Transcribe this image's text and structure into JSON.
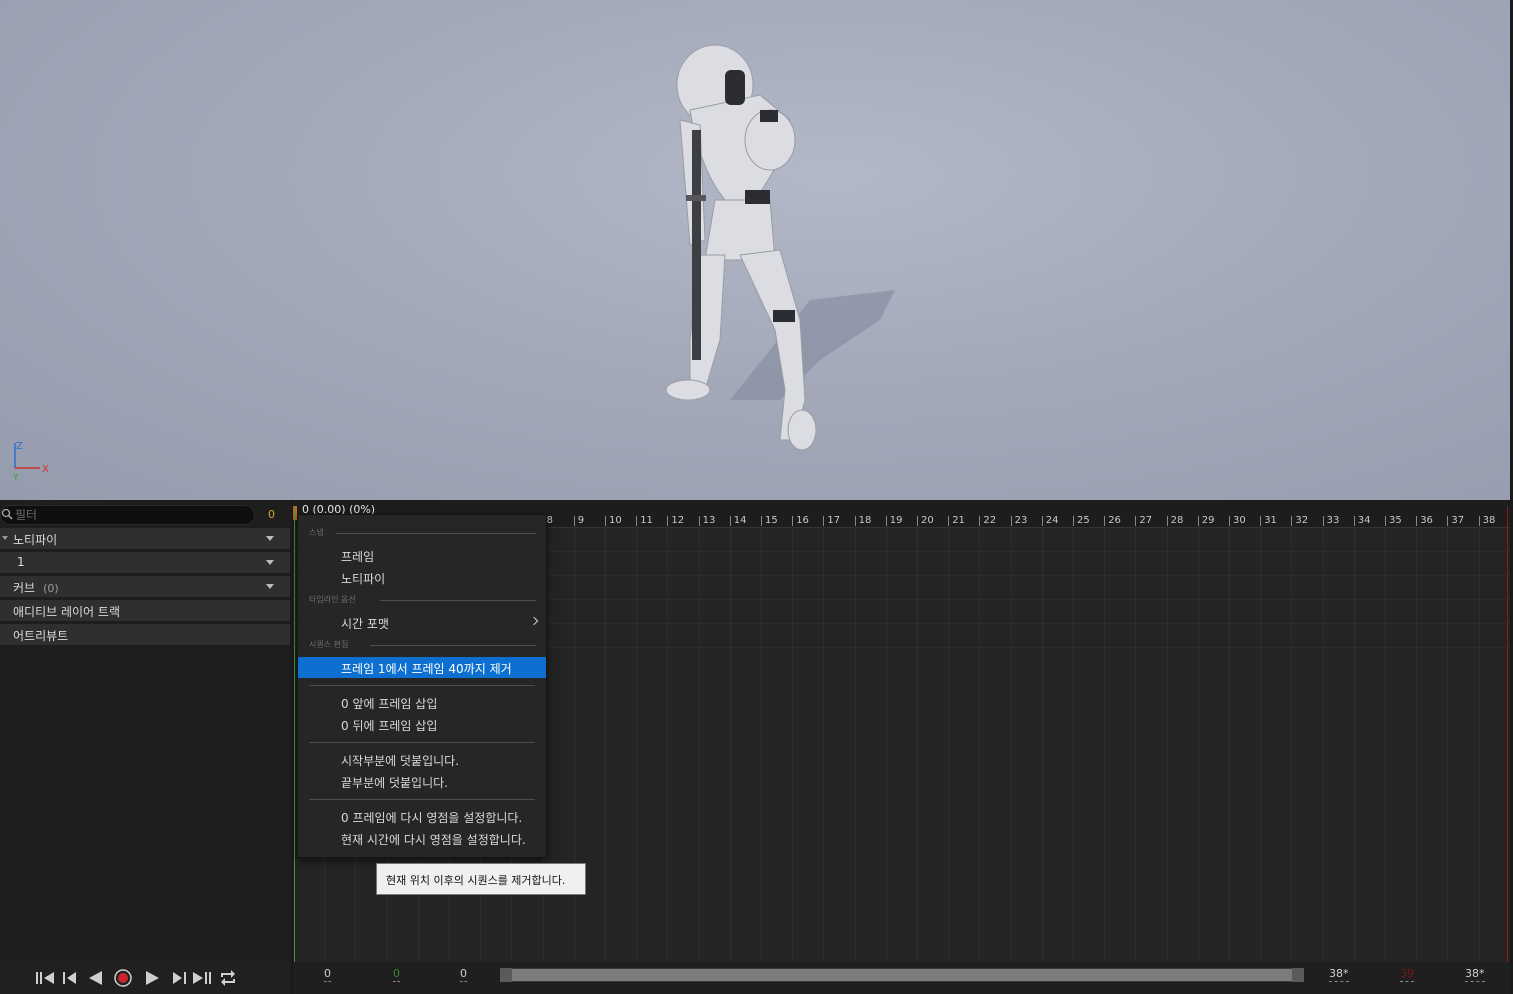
{
  "viewport": {
    "axis": {
      "z": "Z",
      "x": "X",
      "y": "Y"
    }
  },
  "left_panel": {
    "search": {
      "placeholder": "필터",
      "count": "0"
    },
    "tracks": [
      {
        "label": "노티파이",
        "has_dropdown": true
      },
      {
        "label": "1",
        "has_dropdown": true
      },
      {
        "label": "커브",
        "sub": "(0)",
        "has_dropdown": true
      },
      {
        "label": "애디티브 레이어 트랙"
      },
      {
        "label": "어트리뷰트"
      }
    ]
  },
  "timeline": {
    "playhead_label": "0 (0.00) (0%)",
    "ticks": [
      "8",
      "9",
      "10",
      "11",
      "12",
      "13",
      "14",
      "15",
      "16",
      "17",
      "18",
      "19",
      "20",
      "21",
      "22",
      "23",
      "24",
      "25",
      "26",
      "27",
      "28",
      "29",
      "30",
      "31",
      "32",
      "33",
      "34",
      "35",
      "36",
      "37",
      "38"
    ]
  },
  "context_menu": {
    "sections": {
      "snap": "스냅",
      "timeline_options": "타임라인 옵션",
      "sequence_edit": "시퀀스 편집"
    },
    "items": {
      "frame": "프레임",
      "notify": "노티파이",
      "time_format": "시간 포맷",
      "remove_frames": "프레임 1에서 프레임 40까지 제거",
      "insert_before": "0 앞에 프레임 삽입",
      "insert_after": "0 뒤에 프레임 삽입",
      "append_start": "시작부분에 덧붙입니다.",
      "append_end": "끝부분에 덧붙입니다.",
      "rezero_frame": "0 프레임에 다시 영점을 설정합니다.",
      "rezero_current": "현재 시간에 다시 영점을 설정합니다."
    },
    "tooltip": "현재 위치 이후의 시퀀스를 제거합니다."
  },
  "transport": {
    "buttons": [
      "to-start",
      "step-back",
      "play-reverse",
      "record",
      "play",
      "step-forward",
      "to-end",
      "loop"
    ]
  },
  "range_bar": {
    "start": "0",
    "working_start": "0",
    "view_start": "0",
    "view_end": "38*",
    "playback_end": "39",
    "working_end": "38*"
  },
  "colors": {
    "highlight": "#0d70d1",
    "playhead": "#3a9a3a",
    "end_marker": "#8a1a1a",
    "accent_orange": "#e0a030"
  }
}
